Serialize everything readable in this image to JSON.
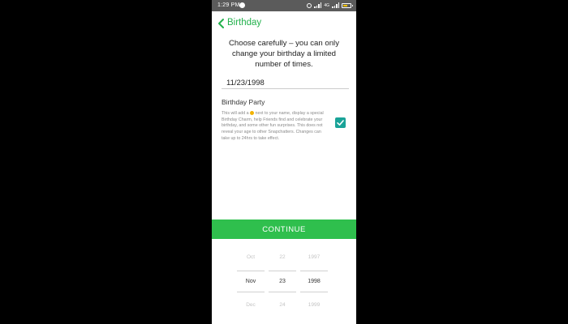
{
  "status_bar": {
    "time": "1:29",
    "meridiem": "PM",
    "network_label": "4G"
  },
  "header": {
    "back_icon": "chevron-left-icon",
    "title": "Birthday"
  },
  "intro_text": "Choose carefully – you can only change your birthday a limited number of times.",
  "birthday_field": {
    "value": "11/23/1998"
  },
  "birthday_party": {
    "title": "Birthday Party",
    "description_before_icon": "This will add a ",
    "description_icon": "cake-emoji-icon",
    "description_after_icon": " next to your name, display a special Birthday Charm, help Friends find and celebrate your birthday, and some other fun surprises. This does not reveal your age to other Snapchatters. Changes can take up to 24hrs to take effect.",
    "checked": true
  },
  "continue_label": "CONTINUE",
  "date_picker": {
    "month": {
      "prev": "Oct",
      "selected": "Nov",
      "next": "Dec"
    },
    "day": {
      "prev": "22",
      "selected": "23",
      "next": "24"
    },
    "year": {
      "prev": "1997",
      "selected": "1998",
      "next": "1999"
    }
  },
  "colors": {
    "accent_green": "#22b14c",
    "continue_green": "#2fbf4d",
    "checkbox_teal": "#1aa398",
    "status_bar": "#5b5b5b"
  }
}
